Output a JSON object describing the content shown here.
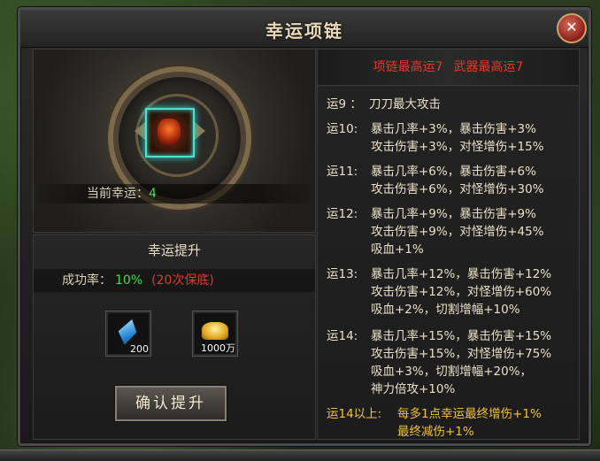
{
  "window": {
    "title": "幸运项链",
    "close_symbol": "✕"
  },
  "lucky": {
    "current_label": "当前幸运：",
    "current_value": "4"
  },
  "upgrade": {
    "title": "幸运提升",
    "rate_label": "成功率：",
    "rate_value": "10%",
    "guarantee": "(20次保底)",
    "items": [
      {
        "icon": "blue-crystal-icon",
        "count": "200"
      },
      {
        "icon": "gold-ingot-icon",
        "count": "1000万"
      }
    ],
    "confirm_label": "确认提升"
  },
  "max": {
    "necklace": "项链最高运7",
    "weapon": "武器最高运7"
  },
  "rules": [
    {
      "level": "运9 ：",
      "lines": [
        "刀刀最大攻击"
      ]
    },
    {
      "level": "运10:",
      "lines": [
        "暴击几率+3%，暴击伤害+3%",
        "攻击伤害+3%，对怪增伤+15%"
      ]
    },
    {
      "level": "运11:",
      "lines": [
        "暴击几率+6%，暴击伤害+6%",
        "攻击伤害+6%，对怪增伤+30%"
      ]
    },
    {
      "level": "运12:",
      "lines": [
        "暴击几率+9%，暴击伤害+9%",
        "攻击伤害+9%，对怪增伤+45%",
        "吸血+1%"
      ]
    },
    {
      "level": "运13:",
      "lines": [
        "暴击几率+12%，暴击伤害+12%",
        "攻击伤害+12%，对怪增伤+60%",
        "吸血+2%，切割增幅+10%"
      ]
    },
    {
      "level": "运14:",
      "lines": [
        "暴击几率+15%，暴击伤害+15%",
        "攻击伤害+15%，对怪增伤+75%",
        "吸血+3%，切割增幅+20%，",
        "神力倍攻+10%"
      ]
    },
    {
      "level": "运14以上:",
      "lines": [
        "每多1点幸运最终增伤+1%",
        "最终减伤+1%"
      ]
    }
  ]
}
